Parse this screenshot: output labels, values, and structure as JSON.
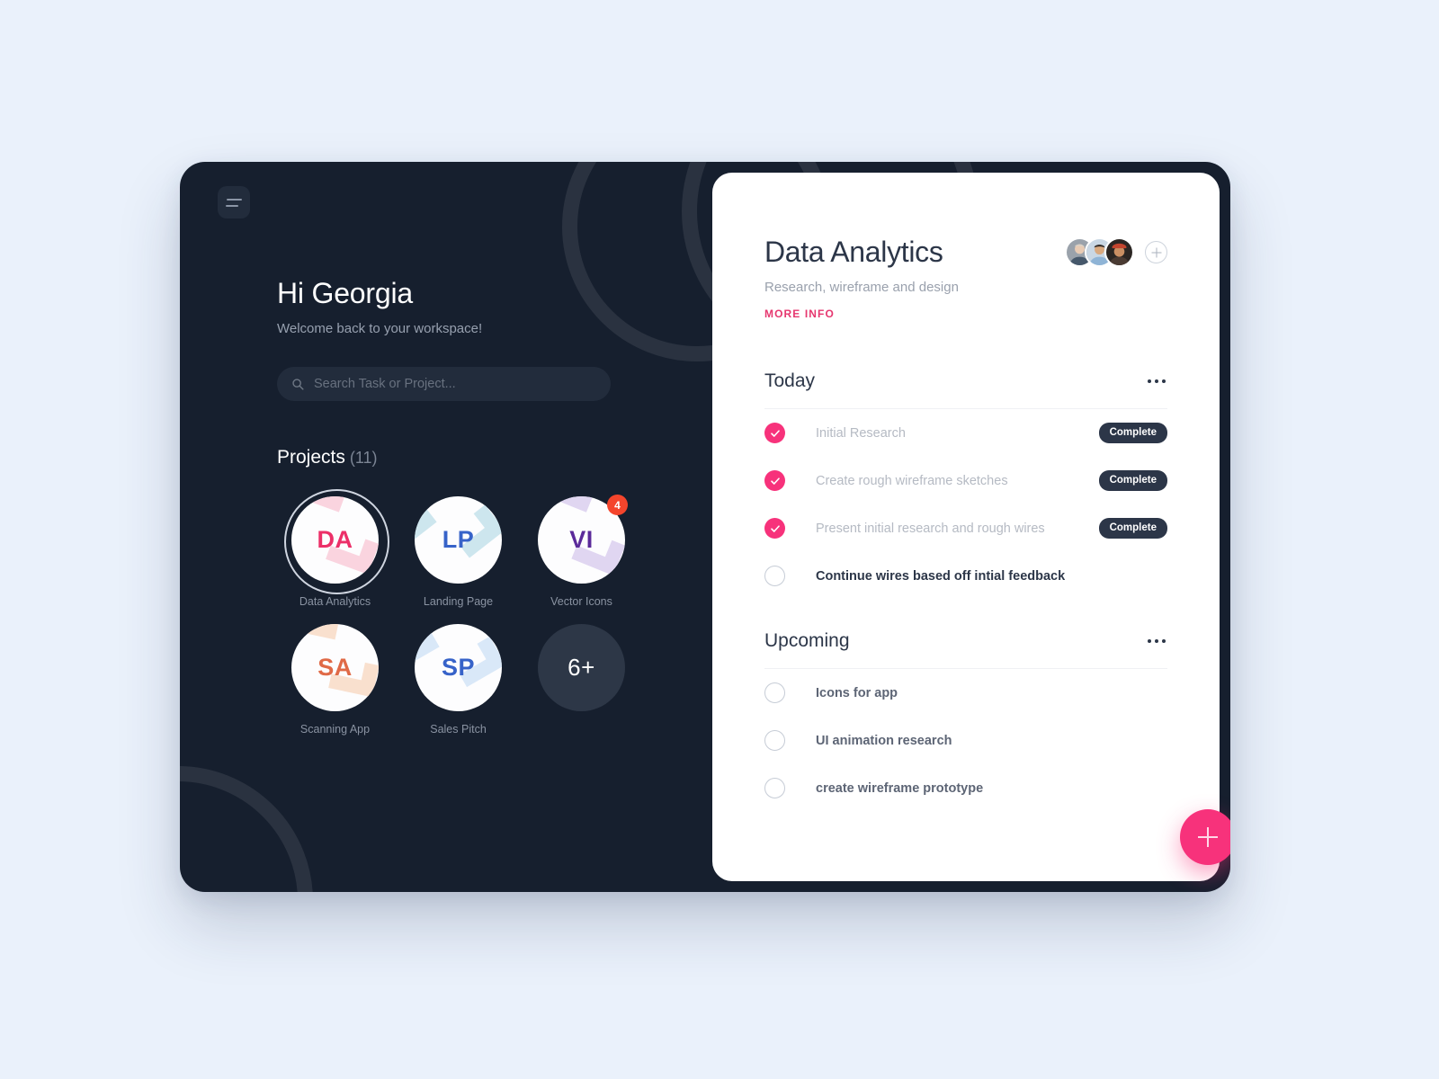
{
  "app": {
    "menu_icon": "hamburger-icon"
  },
  "sidebar": {
    "greeting": "Hi Georgia",
    "subtitle": "Welcome back to your workspace!",
    "search": {
      "placeholder": "Search Task or Project...",
      "value": "",
      "icon": "search-icon"
    },
    "projects": {
      "title": "Projects",
      "count": "(11)",
      "items": [
        {
          "initials": "DA",
          "name": "Data Analytics",
          "color": "#ec2f68",
          "pattern": "#f9cfdc",
          "active": true,
          "badge": ""
        },
        {
          "initials": "LP",
          "name": "Landing Page",
          "color": "#3763c9",
          "pattern": "#c8e3ec",
          "active": false,
          "badge": ""
        },
        {
          "initials": "VI",
          "name": "Vector Icons",
          "color": "#5b2a9a",
          "pattern": "#ddd2ef",
          "active": false,
          "badge": "4"
        },
        {
          "initials": "SA",
          "name": "Scanning App",
          "color": "#e06a47",
          "pattern": "#f8ddc9",
          "active": false,
          "badge": ""
        },
        {
          "initials": "SP",
          "name": "Sales Pitch",
          "color": "#3763c9",
          "pattern": "#d5e6f7",
          "active": false,
          "badge": ""
        },
        {
          "initials": "6+",
          "name": "",
          "color": "#ffffff",
          "pattern": "",
          "active": false,
          "badge": "",
          "more": true
        }
      ]
    }
  },
  "card": {
    "title": "Data Analytics",
    "description": "Research, wireframe and design",
    "more_info_label": "MORE INFO",
    "avatar_add_label": "add-member",
    "sections": [
      {
        "title": "Today",
        "menu_icon": "more-options-icon",
        "tasks": [
          {
            "label": "Initial Research",
            "done": true,
            "status": "Complete"
          },
          {
            "label": "Create rough wireframe sketches",
            "done": true,
            "status": "Complete"
          },
          {
            "label": "Present initial research and rough wires",
            "done": true,
            "status": "Complete"
          },
          {
            "label": "Continue wires based off intial feedback",
            "done": false,
            "status": ""
          }
        ]
      },
      {
        "title": "Upcoming",
        "menu_icon": "more-options-icon",
        "tasks": [
          {
            "label": "Icons for app",
            "done": false,
            "status": ""
          },
          {
            "label": "UI animation research",
            "done": false,
            "status": ""
          },
          {
            "label": "create wireframe prototype",
            "done": false,
            "status": ""
          }
        ]
      }
    ],
    "fab_label": "add-task"
  },
  "colors": {
    "accent_pink": "#f7327b",
    "accent_magenta": "#e6376f",
    "dark": "#161f2e",
    "badge_red": "#f4452c",
    "page_bg": "#eaf1fb"
  }
}
